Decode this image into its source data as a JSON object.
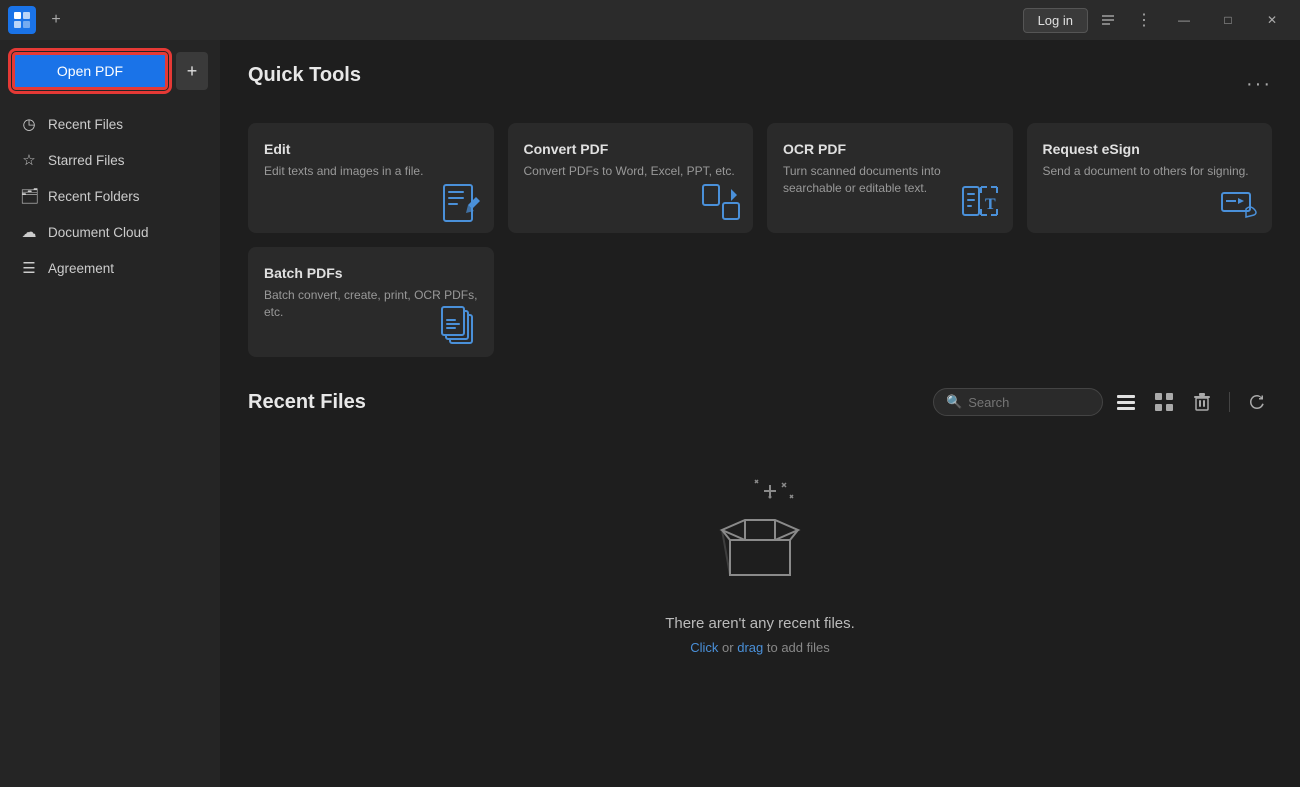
{
  "titlebar": {
    "app_icon_label": "F",
    "tab_add_label": "+",
    "login_label": "Log in",
    "more_icon": "⋮",
    "minimize_icon": "—",
    "maximize_icon": "□",
    "close_icon": "✕"
  },
  "sidebar": {
    "open_pdf_label": "Open PDF",
    "add_label": "+",
    "nav_items": [
      {
        "id": "recent-files",
        "icon": "🕐",
        "label": "Recent Files"
      },
      {
        "id": "starred-files",
        "icon": "☆",
        "label": "Starred Files"
      },
      {
        "id": "recent-folders",
        "icon": "🗂",
        "label": "Recent Folders"
      },
      {
        "id": "document-cloud",
        "icon": "☁",
        "label": "Document Cloud"
      },
      {
        "id": "agreement",
        "icon": "☰",
        "label": "Agreement"
      }
    ]
  },
  "quick_tools": {
    "title": "Quick Tools",
    "more_label": "···",
    "tools": [
      {
        "id": "edit",
        "title": "Edit",
        "description": "Edit texts and images in a file.",
        "icon_type": "edit"
      },
      {
        "id": "convert-pdf",
        "title": "Convert PDF",
        "description": "Convert PDFs to Word, Excel, PPT, etc.",
        "icon_type": "convert"
      },
      {
        "id": "ocr-pdf",
        "title": "OCR PDF",
        "description": "Turn scanned documents into searchable or editable text.",
        "icon_type": "ocr"
      },
      {
        "id": "request-esign",
        "title": "Request eSign",
        "description": "Send a document to others for signing.",
        "icon_type": "esign"
      },
      {
        "id": "batch-pdfs",
        "title": "Batch PDFs",
        "description": "Batch convert, create, print, OCR PDFs, etc.",
        "icon_type": "batch"
      }
    ]
  },
  "recent_files": {
    "title": "Recent Files",
    "search_placeholder": "Search",
    "empty_title": "There aren't any recent files.",
    "empty_subtitle_prefix": "",
    "click_label": "Click",
    "or_label": " or ",
    "drag_label": "drag",
    "empty_subtitle_suffix": " to add files"
  },
  "icons": {
    "search": "🔍",
    "list_view": "☰",
    "grid_view": "⊞",
    "delete": "🗑",
    "refresh": "↻"
  }
}
